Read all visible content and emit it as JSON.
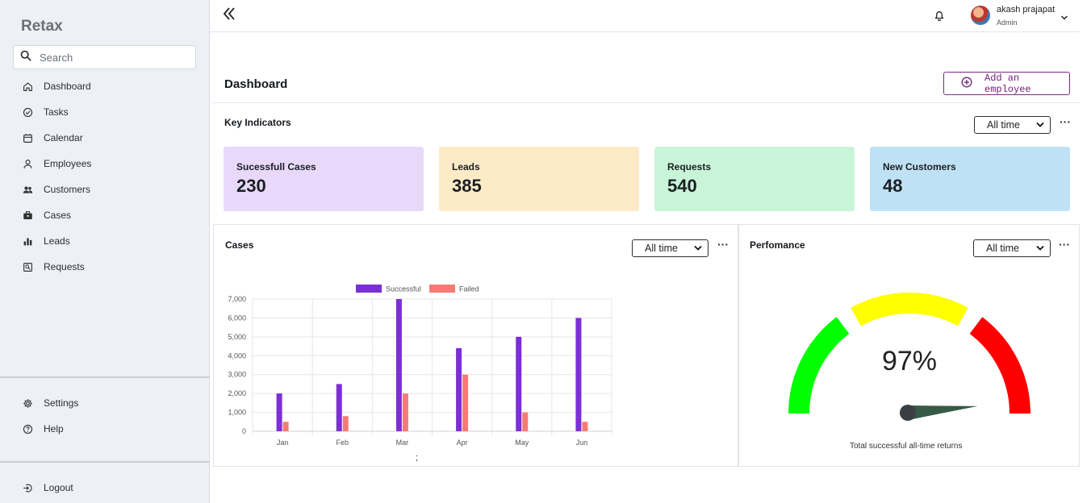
{
  "sidebar": {
    "brand": "Retax",
    "search_placeholder": "Search",
    "items": [
      {
        "label": "Dashboard",
        "icon": "home-icon"
      },
      {
        "label": "Tasks",
        "icon": "check-circle-icon"
      },
      {
        "label": "Calendar",
        "icon": "calendar-icon"
      },
      {
        "label": "Employees",
        "icon": "user-icon"
      },
      {
        "label": "Customers",
        "icon": "users-icon"
      },
      {
        "label": "Cases",
        "icon": "briefcase-icon"
      },
      {
        "label": "Leads",
        "icon": "bar-chart-icon"
      },
      {
        "label": "Requests",
        "icon": "request-icon"
      }
    ],
    "bottom_items": [
      {
        "label": "Settings",
        "icon": "gear-icon"
      },
      {
        "label": "Help",
        "icon": "help-icon"
      }
    ],
    "logout": "Logout"
  },
  "header": {
    "user_name": "akash prajapat",
    "user_role": "Admin"
  },
  "main": {
    "title": "Dashboard",
    "add_button": "Add an employee",
    "key_indicators": {
      "title": "Key Indicators",
      "filter": "All time",
      "cards": [
        {
          "label": "Sucessfull Cases",
          "value": "230",
          "color": "#e8d9fb"
        },
        {
          "label": "Leads",
          "value": "385",
          "color": "#fdebc8"
        },
        {
          "label": "Requests",
          "value": "540",
          "color": "#c8f5d8"
        },
        {
          "label": "New Customers",
          "value": "48",
          "color": "#bfe1f5"
        }
      ]
    },
    "cases_panel": {
      "title": "Cases",
      "filter": "All time",
      "footer_text": ";"
    },
    "performance_panel": {
      "title": "Perfomance",
      "filter": "All time",
      "value_text": "97%",
      "value": 97,
      "caption": "Total successful all-time returns",
      "gauge_colors": [
        "#00ff00",
        "#ffff00",
        "#ff0000"
      ]
    }
  },
  "chart_data": {
    "type": "bar",
    "categories": [
      "Jan",
      "Feb",
      "Mar",
      "Apr",
      "May",
      "Jun"
    ],
    "series": [
      {
        "name": "Successful",
        "values": [
          2000,
          2500,
          7000,
          4400,
          5000,
          6000
        ],
        "color": "#7b2fd4"
      },
      {
        "name": "Failed",
        "values": [
          500,
          800,
          2000,
          3000,
          1000,
          500
        ],
        "color": "#f77b73"
      }
    ],
    "ylim": [
      0,
      7000
    ],
    "yticks": [
      "0",
      "1,000",
      "2,000",
      "3,000",
      "4,000",
      "5,000",
      "6,000",
      "7,000"
    ],
    "legend": "top",
    "grid": true
  }
}
